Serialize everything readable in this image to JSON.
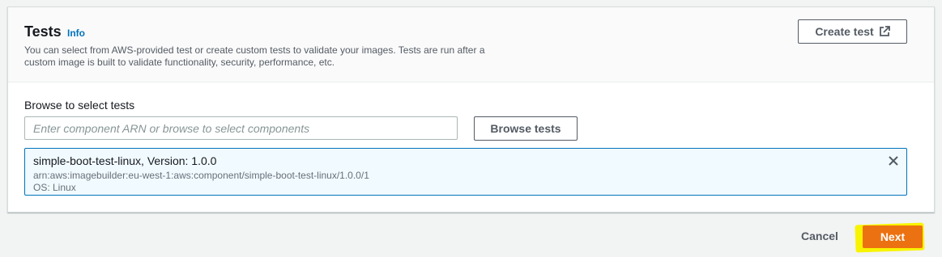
{
  "header": {
    "title": "Tests",
    "info_label": "Info",
    "description_line1": "You can select from AWS-provided test or create custom tests to validate your images. Tests are run after a",
    "description_line2": "custom image is built to validate functionality, security, performance, etc.",
    "create_button_label": "Create test",
    "create_button_icon": "external-link-icon"
  },
  "browse": {
    "label": "Browse to select tests",
    "input_value": "",
    "input_placeholder": "Enter component ARN or browse to select components",
    "button_label": "Browse tests"
  },
  "selected_tests": [
    {
      "name": "simple-boot-test-linux, Version: 1.0.0",
      "arn": "arn:aws:imagebuilder:eu-west-1:aws:component/simple-boot-test-linux/1.0.0/1",
      "os": "OS: Linux",
      "remove_icon": "close-icon"
    }
  ],
  "footer": {
    "cancel_label": "Cancel",
    "next_label": "Next"
  },
  "colors": {
    "primary": "#ec7211",
    "link": "#0073bb",
    "token_background": "#f1faff",
    "highlight": "#f8f400"
  }
}
